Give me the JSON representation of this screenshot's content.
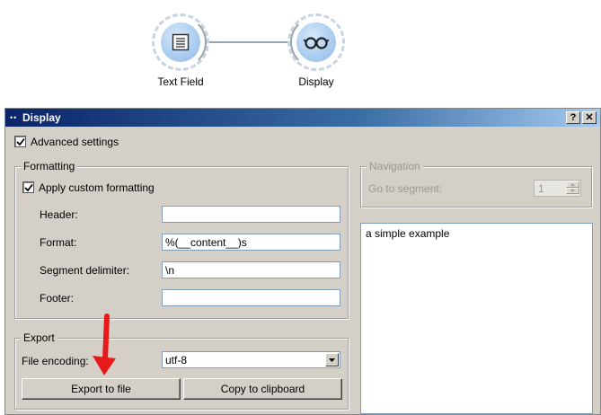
{
  "canvas": {
    "nodes": [
      {
        "label": "Text Field",
        "icon": "document-lines-icon"
      },
      {
        "label": "Display",
        "icon": "glasses-icon"
      }
    ]
  },
  "window": {
    "title": "Display",
    "help_button": "?",
    "close_button": "✕"
  },
  "advanced": {
    "label": "Advanced settings",
    "checked": true
  },
  "formatting": {
    "group_title": "Formatting",
    "apply_custom": {
      "label": "Apply custom formatting",
      "checked": true
    },
    "header": {
      "label": "Header:",
      "value": ""
    },
    "format": {
      "label": "Format:",
      "value": "%(__content__)s"
    },
    "segment_delimiter": {
      "label": "Segment delimiter:",
      "value": "\\n"
    },
    "footer": {
      "label": "Footer:",
      "value": ""
    }
  },
  "export": {
    "group_title": "Export",
    "file_encoding": {
      "label": "File encoding:",
      "value": "utf-8"
    },
    "export_button": "Export to file",
    "copy_button": "Copy to clipboard"
  },
  "navigation": {
    "group_title": "Navigation",
    "goto_label": "Go to segment:",
    "goto_value": "1"
  },
  "output": {
    "text": "a simple example"
  },
  "annotation": {
    "arrow_color": "#e8191b"
  },
  "colors": {
    "title_start": "#0a246a",
    "node_fill": "#a9cbee",
    "dialog_bg": "#d4d0c8"
  }
}
